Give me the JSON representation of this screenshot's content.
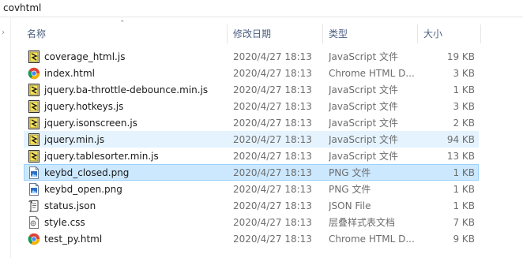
{
  "window": {
    "path": "covhtml"
  },
  "columns": {
    "name": "名称",
    "date": "修改日期",
    "type": "类型",
    "size": "大小",
    "sort_indicator": "^"
  },
  "files": [
    {
      "name": "coverage_html.js",
      "date": "2020/4/27 18:13",
      "type": "JavaScript 文件",
      "size": "19 KB",
      "icon": "js-file-icon",
      "state": "normal"
    },
    {
      "name": "index.html",
      "date": "2020/4/27 18:13",
      "type": "Chrome HTML D...",
      "size": "3 KB",
      "icon": "chrome-html-icon",
      "state": "normal"
    },
    {
      "name": "jquery.ba-throttle-debounce.min.js",
      "date": "2020/4/27 18:13",
      "type": "JavaScript 文件",
      "size": "1 KB",
      "icon": "js-file-icon",
      "state": "normal"
    },
    {
      "name": "jquery.hotkeys.js",
      "date": "2020/4/27 18:13",
      "type": "JavaScript 文件",
      "size": "3 KB",
      "icon": "js-file-icon",
      "state": "normal"
    },
    {
      "name": "jquery.isonscreen.js",
      "date": "2020/4/27 18:13",
      "type": "JavaScript 文件",
      "size": "2 KB",
      "icon": "js-file-icon",
      "state": "normal"
    },
    {
      "name": "jquery.min.js",
      "date": "2020/4/27 18:13",
      "type": "JavaScript 文件",
      "size": "94 KB",
      "icon": "js-file-icon",
      "state": "hover"
    },
    {
      "name": "jquery.tablesorter.min.js",
      "date": "2020/4/27 18:13",
      "type": "JavaScript 文件",
      "size": "13 KB",
      "icon": "js-file-icon",
      "state": "normal"
    },
    {
      "name": "keybd_closed.png",
      "date": "2020/4/27 18:13",
      "type": "PNG 文件",
      "size": "1 KB",
      "icon": "png-file-icon",
      "state": "selected"
    },
    {
      "name": "keybd_open.png",
      "date": "2020/4/27 18:13",
      "type": "PNG 文件",
      "size": "1 KB",
      "icon": "png-file-icon",
      "state": "normal"
    },
    {
      "name": "status.json",
      "date": "2020/4/27 18:13",
      "type": "JSON File",
      "size": "1 KB",
      "icon": "json-file-icon",
      "state": "normal"
    },
    {
      "name": "style.css",
      "date": "2020/4/27 18:13",
      "type": "层叠样式表文档",
      "size": "7 KB",
      "icon": "css-file-icon",
      "state": "normal"
    },
    {
      "name": "test_py.html",
      "date": "2020/4/27 18:13",
      "type": "Chrome HTML D...",
      "size": "9 KB",
      "icon": "chrome-html-icon",
      "state": "normal"
    }
  ]
}
